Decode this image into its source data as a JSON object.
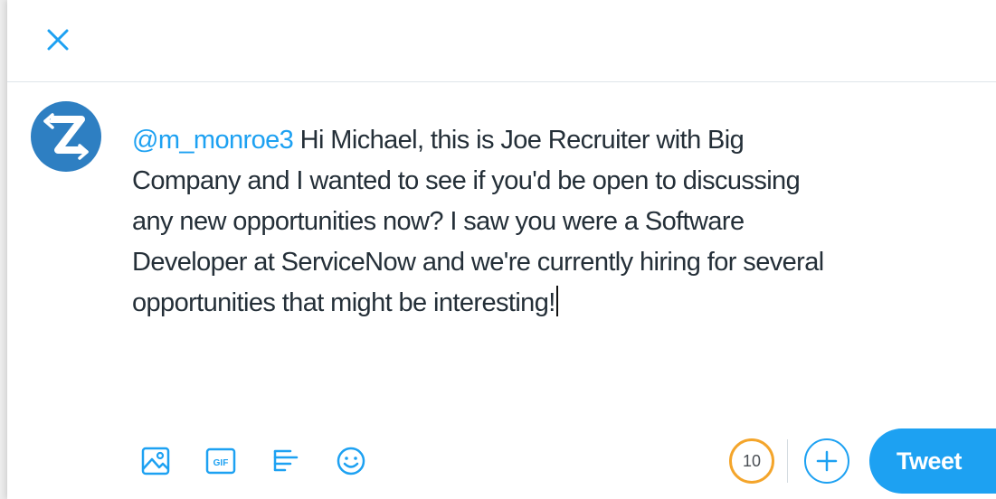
{
  "compose": {
    "mention": "@m_monroe3",
    "lines": [
      " Hi Michael, this is Joe Recruiter with Big",
      "Company and I wanted to see if you'd be open to discussing",
      "any new opportunities now?  I saw you were a Software",
      "Developer at ServiceNow and we're currently hiring for several",
      "opportunities that might be interesting!"
    ]
  },
  "avatar": {
    "letter": "Z",
    "color": "#2e7fc2"
  },
  "toolbar": {
    "icons": [
      "image-icon",
      "gif-icon",
      "poll-icon",
      "emoji-icon"
    ],
    "gif_label": "GIF"
  },
  "counter": {
    "remaining": "10",
    "color": "#f4a52b"
  },
  "tweet_button": {
    "label": "Tweet",
    "color": "#1da1f2"
  },
  "icons": {
    "close": "close-icon",
    "add": "plus-icon"
  }
}
